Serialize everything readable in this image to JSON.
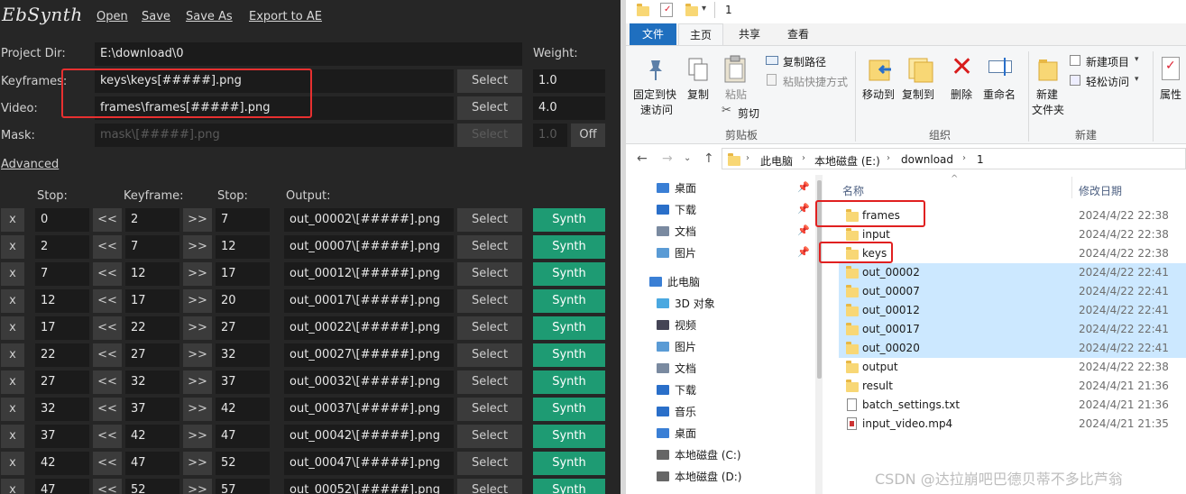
{
  "ebsynth": {
    "logo": "EbSynth",
    "menu": [
      "Open",
      "Save",
      "Save As",
      "Export to AE"
    ],
    "project_dir_label": "Project Dir:",
    "project_dir_value": "E:\\download\\0",
    "weight_label": "Weight:",
    "keyframes_label": "Keyframes:",
    "keyframes_value": "keys\\keys[#####].png",
    "keyframes_weight": "1.0",
    "video_label": "Video:",
    "video_value": "frames\\frames[#####].png",
    "video_weight": "4.0",
    "mask_label": "Mask:",
    "mask_value": "mask\\[#####].png",
    "mask_weight": "1.0",
    "mask_toggle": "Off",
    "select_label": "Select",
    "advanced_label": "Advanced",
    "headers": {
      "stop": "Stop:",
      "keyframe": "Keyframe:",
      "stop2": "Stop:",
      "output": "Output:"
    },
    "x_label": "x",
    "prev_label": "<<",
    "next_label": ">>",
    "synth_label": "Synth",
    "rows": [
      {
        "start": "0",
        "key": "2",
        "stop": "7",
        "output": "out_00002\\[#####].png"
      },
      {
        "start": "2",
        "key": "7",
        "stop": "12",
        "output": "out_00007\\[#####].png"
      },
      {
        "start": "7",
        "key": "12",
        "stop": "17",
        "output": "out_00012\\[#####].png"
      },
      {
        "start": "12",
        "key": "17",
        "stop": "20",
        "output": "out_00017\\[#####].png"
      },
      {
        "start": "17",
        "key": "22",
        "stop": "27",
        "output": "out_00022\\[#####].png"
      },
      {
        "start": "22",
        "key": "27",
        "stop": "32",
        "output": "out_00027\\[#####].png"
      },
      {
        "start": "27",
        "key": "32",
        "stop": "37",
        "output": "out_00032\\[#####].png"
      },
      {
        "start": "32",
        "key": "37",
        "stop": "42",
        "output": "out_00037\\[#####].png"
      },
      {
        "start": "37",
        "key": "42",
        "stop": "47",
        "output": "out_00042\\[#####].png"
      },
      {
        "start": "42",
        "key": "47",
        "stop": "52",
        "output": "out_00047\\[#####].png"
      },
      {
        "start": "47",
        "key": "52",
        "stop": "57",
        "output": "out_00052\\[#####].png"
      }
    ]
  },
  "explorer": {
    "title": "1",
    "tabs": [
      "文件",
      "主页",
      "共享",
      "查看"
    ],
    "ribbon": {
      "pin": "固定到快速访问",
      "pin_l1": "固定到快",
      "pin_l2": "速访问",
      "copy": "复制",
      "paste": "粘贴",
      "copy_path": "复制路径",
      "paste_shortcut": "粘贴快捷方式",
      "cut": "剪切",
      "clipboard_group": "剪贴板",
      "move_to": "移动到",
      "copy_to": "复制到",
      "delete": "删除",
      "rename": "重命名",
      "organize_group": "组织",
      "new_item": "新建项目",
      "easy_access": "轻松访问",
      "new_folder_l1": "新建",
      "new_folder_l2": "文件夹",
      "new_group": "新建",
      "properties": "属性"
    },
    "breadcrumb": [
      "此电脑",
      "本地磁盘 (E:)",
      "download",
      "1"
    ],
    "nav": [
      {
        "label": "桌面",
        "pinned": true
      },
      {
        "label": "下载",
        "pinned": true
      },
      {
        "label": "文档",
        "pinned": true
      },
      {
        "label": "图片",
        "pinned": true
      },
      {
        "label": "此电脑",
        "pinned": false
      },
      {
        "label": "3D 对象",
        "pinned": false
      },
      {
        "label": "视频",
        "pinned": false
      },
      {
        "label": "图片",
        "pinned": false
      },
      {
        "label": "文档",
        "pinned": false
      },
      {
        "label": "下载",
        "pinned": false
      },
      {
        "label": "音乐",
        "pinned": false
      },
      {
        "label": "桌面",
        "pinned": false
      },
      {
        "label": "本地磁盘 (C:)",
        "pinned": false
      },
      {
        "label": "本地磁盘 (D:)",
        "pinned": false
      }
    ],
    "columns": {
      "name": "名称",
      "date": "修改日期"
    },
    "files": [
      {
        "name": "frames",
        "date": "2024/4/22 22:38",
        "type": "folder",
        "selected": false
      },
      {
        "name": "input",
        "date": "2024/4/22 22:38",
        "type": "folder",
        "selected": false
      },
      {
        "name": "keys",
        "date": "2024/4/22 22:38",
        "type": "folder",
        "selected": false
      },
      {
        "name": "out_00002",
        "date": "2024/4/22 22:41",
        "type": "folder",
        "selected": true
      },
      {
        "name": "out_00007",
        "date": "2024/4/22 22:41",
        "type": "folder",
        "selected": true
      },
      {
        "name": "out_00012",
        "date": "2024/4/22 22:41",
        "type": "folder",
        "selected": true
      },
      {
        "name": "out_00017",
        "date": "2024/4/22 22:41",
        "type": "folder",
        "selected": true
      },
      {
        "name": "out_00020",
        "date": "2024/4/22 22:41",
        "type": "folder",
        "selected": true
      },
      {
        "name": "output",
        "date": "2024/4/22 22:38",
        "type": "folder",
        "selected": false
      },
      {
        "name": "result",
        "date": "2024/4/21 21:36",
        "type": "folder",
        "selected": false
      },
      {
        "name": "batch_settings.txt",
        "date": "2024/4/21 21:36",
        "type": "text",
        "selected": false
      },
      {
        "name": "input_video.mp4",
        "date": "2024/4/21 21:35",
        "type": "video",
        "selected": false
      }
    ],
    "watermark": "CSDN @达拉崩吧巴德贝蒂不多比芦翁"
  },
  "colors": {
    "synth_green": "#1e9b73",
    "highlight_red": "#e83030",
    "selection_blue": "#cce8ff"
  }
}
